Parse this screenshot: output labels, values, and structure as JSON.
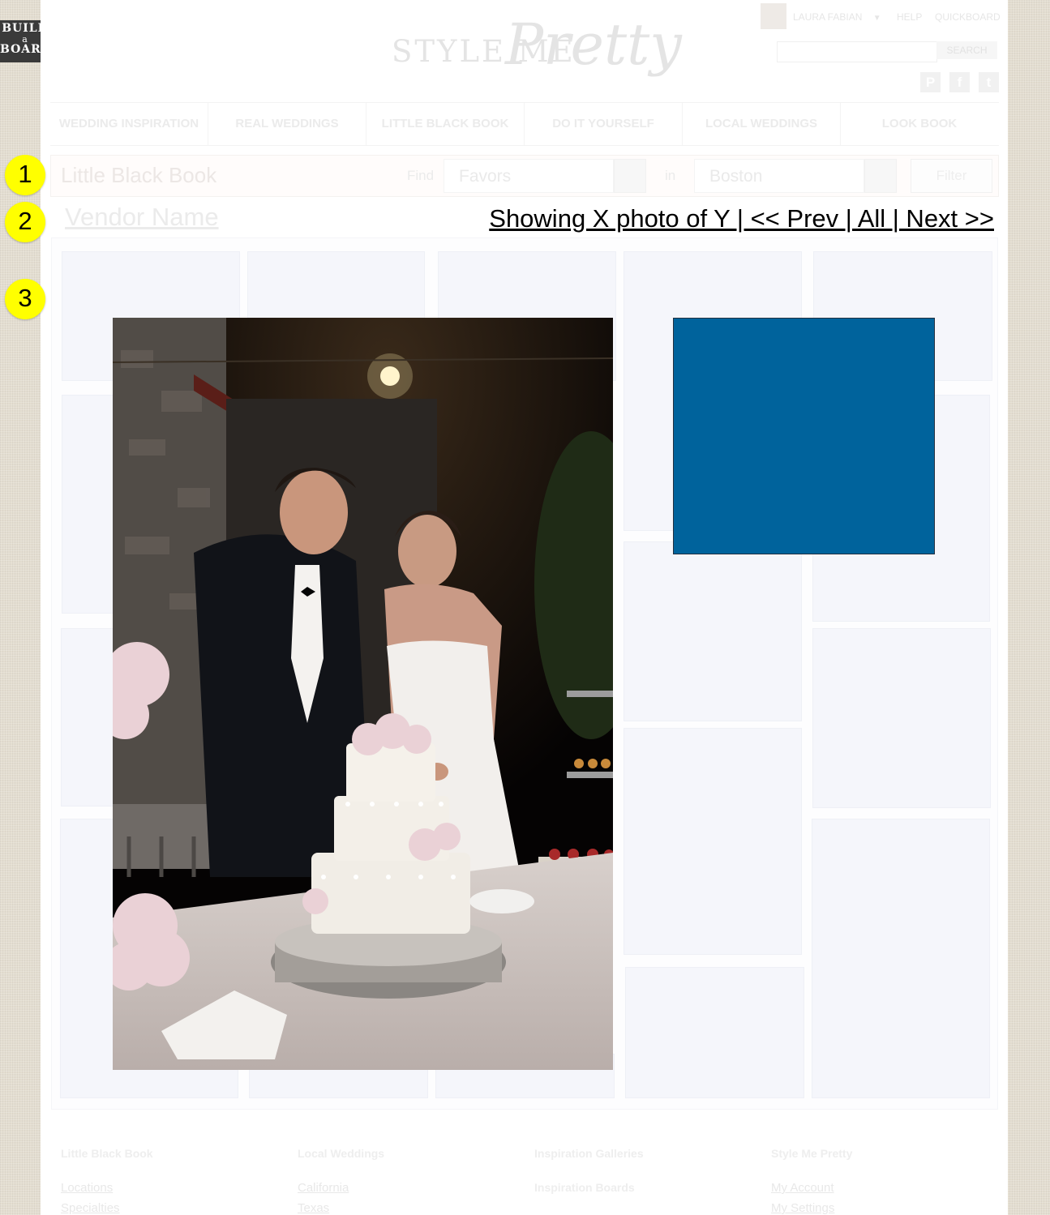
{
  "board_button": {
    "line1": "BUILD",
    "line2": "a",
    "line3": "BOARD"
  },
  "logo": {
    "part1": "STYLE ME",
    "part2": "Pretty"
  },
  "header": {
    "user_name": "LAURA FABIAN",
    "user_menu_caret": "▼",
    "help_label": "HELP",
    "quickboard_label": "QUICKBOARD",
    "search_placeholder": "",
    "search_button": "SEARCH",
    "social": {
      "pinterest": "P",
      "facebook": "f",
      "twitter": "t"
    }
  },
  "nav": [
    {
      "label": "WEDDING INSPIRATION"
    },
    {
      "label": "REAL WEDDINGS"
    },
    {
      "label": "LITTLE BLACK BOOK"
    },
    {
      "label": "DO IT YOURSELF"
    },
    {
      "label": "LOCAL WEDDINGS"
    },
    {
      "label": "LOOK BOOK"
    }
  ],
  "markers": [
    "1",
    "2",
    "3"
  ],
  "search_bar": {
    "title": "Little Black Book",
    "find_label": "Find",
    "category_value": "Favors",
    "in_label": "in",
    "location_value": "Boston",
    "filter_label": "Filter"
  },
  "vendor": {
    "name": "Vendor Name",
    "pager_text": "Showing X photo of Y | << Prev | All | Next >>"
  },
  "colors": {
    "accent_box": "#00639c",
    "marker": "#ffff00",
    "page_bg": "#e3ddd0"
  },
  "footer": {
    "columns": [
      {
        "heading": "Little Black Book",
        "links": [
          "Locations",
          "Specialties"
        ]
      },
      {
        "heading": "Local Weddings",
        "links": [
          "California",
          "Texas"
        ]
      },
      {
        "heading": "Inspiration Galleries",
        "subheading": "Inspiration Boards"
      },
      {
        "heading": "Style Me Pretty",
        "links": [
          "My Account",
          "My Settings"
        ]
      }
    ]
  }
}
